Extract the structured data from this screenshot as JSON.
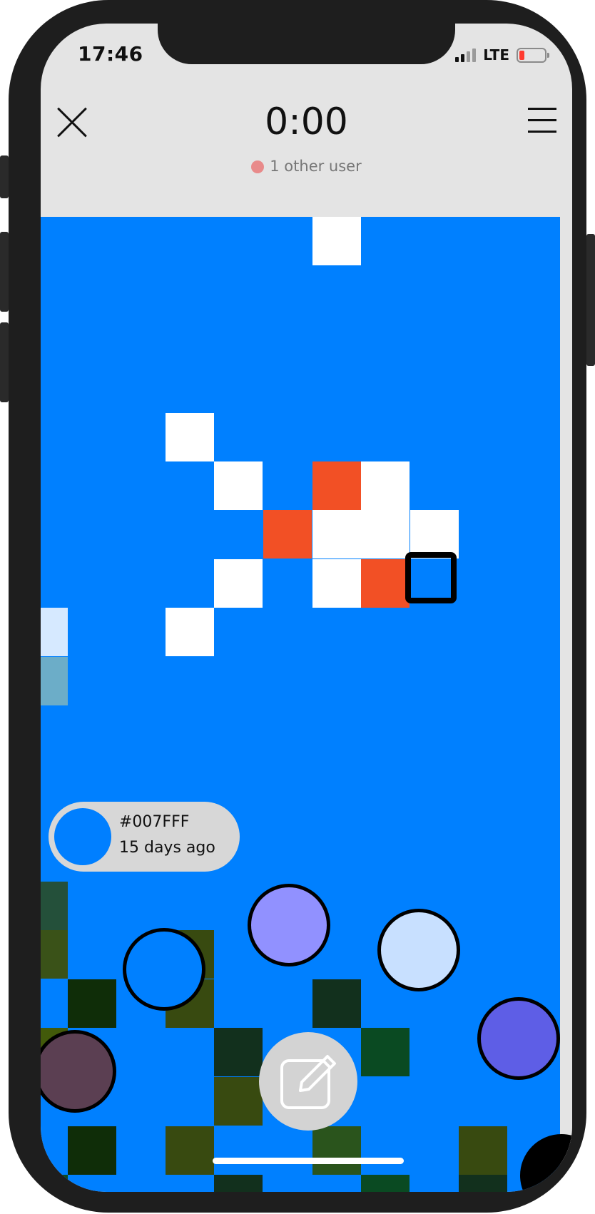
{
  "status_bar": {
    "time": "17:46",
    "network": "LTE",
    "signal_bars": 2,
    "signal_bars_total": 4,
    "battery_level": 0.15,
    "battery_color": "#ff3b30"
  },
  "header": {
    "close_icon": "close-icon",
    "timer": "0:00",
    "users_text": "1 other user",
    "user_dot_color": "#e88a8a",
    "menu_icon": "hamburger-menu-icon"
  },
  "canvas": {
    "background_color": "#0080FF"
  },
  "selected_pixel": {
    "hex": "#007FFF",
    "time_ago": "15 days ago"
  },
  "palette": [
    {
      "color": "#0080FF"
    },
    {
      "color": "#9191FF"
    },
    {
      "color": "#C8E0FF"
    },
    {
      "color": "#5E5EE6"
    },
    {
      "color": "#5B3F52"
    },
    {
      "color": "#000000"
    }
  ],
  "actions": {
    "edit_icon": "edit-pencil-icon"
  }
}
